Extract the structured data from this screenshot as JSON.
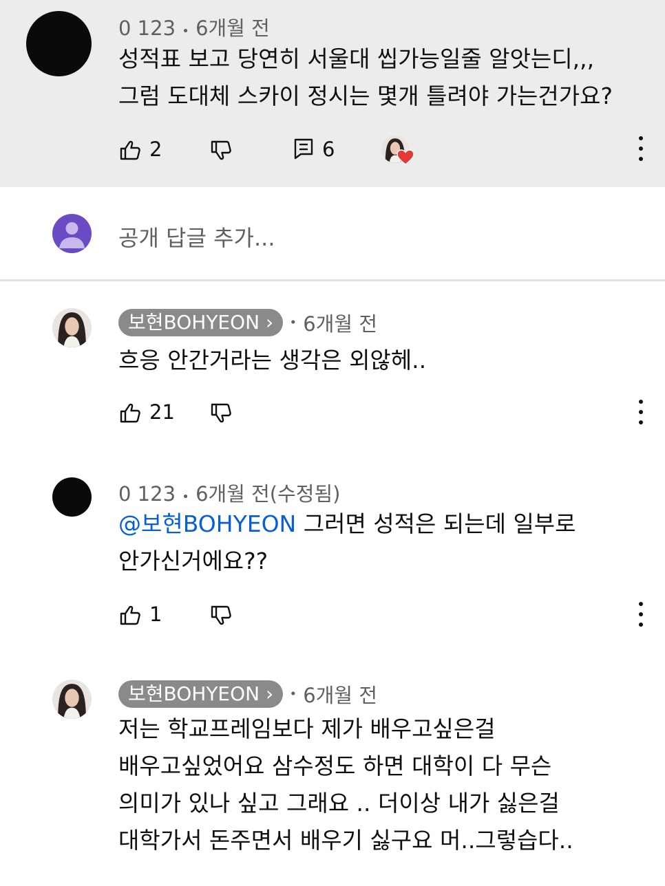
{
  "comment": {
    "author": "0 123",
    "sep": "•",
    "time": "6개월 전",
    "lines": [
      "성적표 보고 당연히 서울대 씹가능일줄 알앗는디,,,",
      "그럼 도대체 스카이 정시는 몇개 틀려야 가는건가요?"
    ],
    "likes": "2",
    "replies": "6"
  },
  "reply_box": {
    "placeholder": "공개 답글 추가..."
  },
  "replies": [
    {
      "author": "보현BOHYEON",
      "chip_arrow": "›",
      "sep": "•",
      "time": "6개월 전",
      "lines": [
        "흐응 안간거라는 생각은 외않헤.."
      ],
      "likes": "21"
    },
    {
      "author": "0 123",
      "sep": "•",
      "time": "6개월 전(수정됨)",
      "mention": "@보현BOHYEON",
      "line1_rest": " 그러면 성적은 되는데 일부로",
      "line2": "안가신거에요??",
      "likes": "1"
    },
    {
      "author": "보현BOHYEON",
      "chip_arrow": "›",
      "sep": "•",
      "time": "6개월 전",
      "lines": [
        "저는 학교프레임보다 제가 배우고싶은걸",
        "배우고싶었어요 삼수정도 하면 대학이 다 무슨",
        "의미가 있나 싶고 그래요 .. 더이상 내가 싫은걸",
        "대학가서 돈주면서 배우기 싫구요 머..그렇습다.."
      ]
    }
  ],
  "colors": {
    "mention": "#065fd4",
    "heart": "#e53935",
    "user_avatar": "#6a4bc4"
  }
}
